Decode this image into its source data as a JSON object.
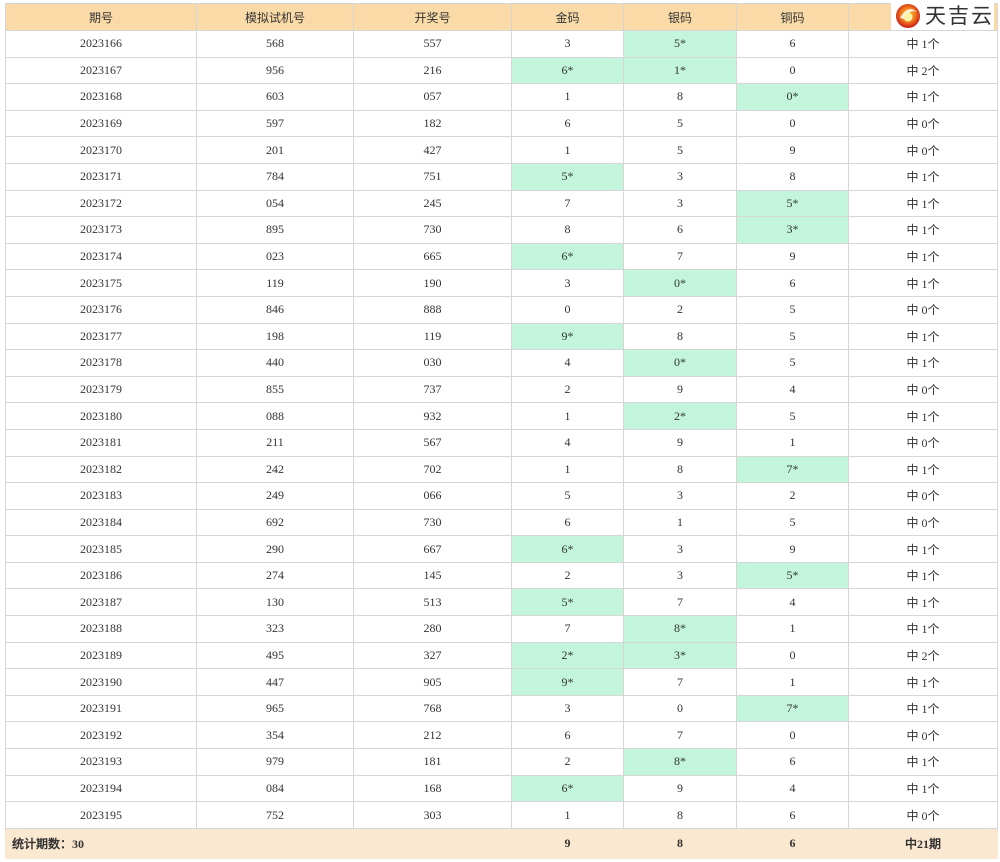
{
  "headers": [
    "期号",
    "模拟试机号",
    "开奖号",
    "金码",
    "银码",
    "铜码",
    ""
  ],
  "logo": {
    "text": "天吉云",
    "icon": "tianjiyun-logo-icon"
  },
  "colors": {
    "header_bg": "#fadba8",
    "hit_bg": "#c3f5dd",
    "footer_bg": "#fbe8d0"
  },
  "rows": [
    {
      "issue": "2023166",
      "sim": "568",
      "draw": "557",
      "gold": "3",
      "silver": "5*",
      "bronze": "6",
      "hits": "中 1个"
    },
    {
      "issue": "2023167",
      "sim": "956",
      "draw": "216",
      "gold": "6*",
      "silver": "1*",
      "bronze": "0",
      "hits": "中 2个"
    },
    {
      "issue": "2023168",
      "sim": "603",
      "draw": "057",
      "gold": "1",
      "silver": "8",
      "bronze": "0*",
      "hits": "中 1个"
    },
    {
      "issue": "2023169",
      "sim": "597",
      "draw": "182",
      "gold": "6",
      "silver": "5",
      "bronze": "0",
      "hits": "中 0个"
    },
    {
      "issue": "2023170",
      "sim": "201",
      "draw": "427",
      "gold": "1",
      "silver": "5",
      "bronze": "9",
      "hits": "中 0个"
    },
    {
      "issue": "2023171",
      "sim": "784",
      "draw": "751",
      "gold": "5*",
      "silver": "3",
      "bronze": "8",
      "hits": "中 1个"
    },
    {
      "issue": "2023172",
      "sim": "054",
      "draw": "245",
      "gold": "7",
      "silver": "3",
      "bronze": "5*",
      "hits": "中 1个"
    },
    {
      "issue": "2023173",
      "sim": "895",
      "draw": "730",
      "gold": "8",
      "silver": "6",
      "bronze": "3*",
      "hits": "中 1个"
    },
    {
      "issue": "2023174",
      "sim": "023",
      "draw": "665",
      "gold": "6*",
      "silver": "7",
      "bronze": "9",
      "hits": "中 1个"
    },
    {
      "issue": "2023175",
      "sim": "119",
      "draw": "190",
      "gold": "3",
      "silver": "0*",
      "bronze": "6",
      "hits": "中 1个"
    },
    {
      "issue": "2023176",
      "sim": "846",
      "draw": "888",
      "gold": "0",
      "silver": "2",
      "bronze": "5",
      "hits": "中 0个"
    },
    {
      "issue": "2023177",
      "sim": "198",
      "draw": "119",
      "gold": "9*",
      "silver": "8",
      "bronze": "5",
      "hits": "中 1个"
    },
    {
      "issue": "2023178",
      "sim": "440",
      "draw": "030",
      "gold": "4",
      "silver": "0*",
      "bronze": "5",
      "hits": "中 1个"
    },
    {
      "issue": "2023179",
      "sim": "855",
      "draw": "737",
      "gold": "2",
      "silver": "9",
      "bronze": "4",
      "hits": "中 0个"
    },
    {
      "issue": "2023180",
      "sim": "088",
      "draw": "932",
      "gold": "1",
      "silver": "2*",
      "bronze": "5",
      "hits": "中 1个"
    },
    {
      "issue": "2023181",
      "sim": "211",
      "draw": "567",
      "gold": "4",
      "silver": "9",
      "bronze": "1",
      "hits": "中 0个"
    },
    {
      "issue": "2023182",
      "sim": "242",
      "draw": "702",
      "gold": "1",
      "silver": "8",
      "bronze": "7*",
      "hits": "中 1个"
    },
    {
      "issue": "2023183",
      "sim": "249",
      "draw": "066",
      "gold": "5",
      "silver": "3",
      "bronze": "2",
      "hits": "中 0个"
    },
    {
      "issue": "2023184",
      "sim": "692",
      "draw": "730",
      "gold": "6",
      "silver": "1",
      "bronze": "5",
      "hits": "中 0个"
    },
    {
      "issue": "2023185",
      "sim": "290",
      "draw": "667",
      "gold": "6*",
      "silver": "3",
      "bronze": "9",
      "hits": "中 1个"
    },
    {
      "issue": "2023186",
      "sim": "274",
      "draw": "145",
      "gold": "2",
      "silver": "3",
      "bronze": "5*",
      "hits": "中 1个"
    },
    {
      "issue": "2023187",
      "sim": "130",
      "draw": "513",
      "gold": "5*",
      "silver": "7",
      "bronze": "4",
      "hits": "中 1个"
    },
    {
      "issue": "2023188",
      "sim": "323",
      "draw": "280",
      "gold": "7",
      "silver": "8*",
      "bronze": "1",
      "hits": "中 1个"
    },
    {
      "issue": "2023189",
      "sim": "495",
      "draw": "327",
      "gold": "2*",
      "silver": "3*",
      "bronze": "0",
      "hits": "中 2个"
    },
    {
      "issue": "2023190",
      "sim": "447",
      "draw": "905",
      "gold": "9*",
      "silver": "7",
      "bronze": "1",
      "hits": "中 1个"
    },
    {
      "issue": "2023191",
      "sim": "965",
      "draw": "768",
      "gold": "3",
      "silver": "0",
      "bronze": "7*",
      "hits": "中 1个"
    },
    {
      "issue": "2023192",
      "sim": "354",
      "draw": "212",
      "gold": "6",
      "silver": "7",
      "bronze": "0",
      "hits": "中 0个"
    },
    {
      "issue": "2023193",
      "sim": "979",
      "draw": "181",
      "gold": "2",
      "silver": "8*",
      "bronze": "6",
      "hits": "中 1个"
    },
    {
      "issue": "2023194",
      "sim": "084",
      "draw": "168",
      "gold": "6*",
      "silver": "9",
      "bronze": "4",
      "hits": "中 1个"
    },
    {
      "issue": "2023195",
      "sim": "752",
      "draw": "303",
      "gold": "1",
      "silver": "8",
      "bronze": "6",
      "hits": "中 0个"
    }
  ],
  "footer": {
    "label": "统计期数：30",
    "sim": "",
    "draw": "",
    "gold": "9",
    "silver": "8",
    "bronze": "6",
    "hits": "中21期"
  }
}
